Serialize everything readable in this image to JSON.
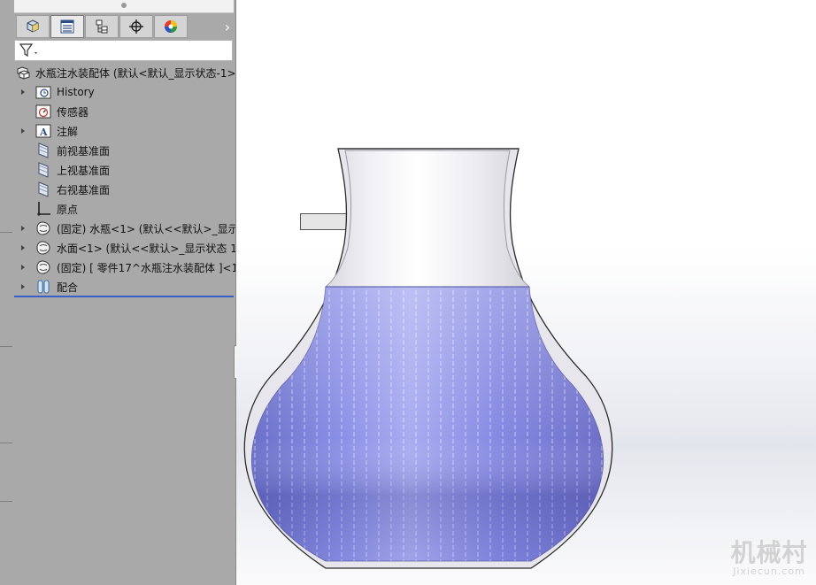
{
  "feature_tree": {
    "tabs": [
      {
        "name": "featuremanager-tab",
        "icon": "assembly-cube-icon"
      },
      {
        "name": "propertymanager-tab",
        "icon": "property-list-icon"
      },
      {
        "name": "configurationmanager-tab",
        "icon": "configuration-icon"
      },
      {
        "name": "dimxpert-tab",
        "icon": "crosshair-icon"
      },
      {
        "name": "display-manager-tab",
        "icon": "appearance-sphere-icon"
      }
    ],
    "root_label": "水瓶注水装配体  (默认<默认_显示状态-1>",
    "items": [
      {
        "label": "History",
        "icon": "history-icon",
        "expandable": true
      },
      {
        "label": "传感器",
        "icon": "sensor-icon",
        "expandable": false
      },
      {
        "label": "注解",
        "icon": "annotation-icon",
        "expandable": true
      },
      {
        "label": "前视基准面",
        "icon": "plane-icon",
        "expandable": false
      },
      {
        "label": "上视基准面",
        "icon": "plane-icon",
        "expandable": false
      },
      {
        "label": "右视基准面",
        "icon": "plane-icon",
        "expandable": false
      },
      {
        "label": "原点",
        "icon": "origin-icon",
        "expandable": false
      },
      {
        "label": "(固定) 水瓶<1> (默认<<默认>_显示",
        "icon": "part-icon",
        "expandable": true
      },
      {
        "label": "水面<1> (默认<<默认>_显示状态 1>",
        "icon": "part-icon",
        "expandable": true
      },
      {
        "label": "(固定) [ 零件17^水瓶注水装配体 ]<1",
        "icon": "part-icon",
        "expandable": true
      },
      {
        "label": "配合",
        "icon": "mates-icon",
        "expandable": true
      }
    ]
  },
  "watermark": {
    "text": "机械村",
    "url": "Jixiecun.com"
  },
  "colors": {
    "panel_bg": "#a9a9a9",
    "water": "#6a6fd8",
    "glass": "#e4e3ea",
    "tree_end_line": "#3a5fc8"
  }
}
